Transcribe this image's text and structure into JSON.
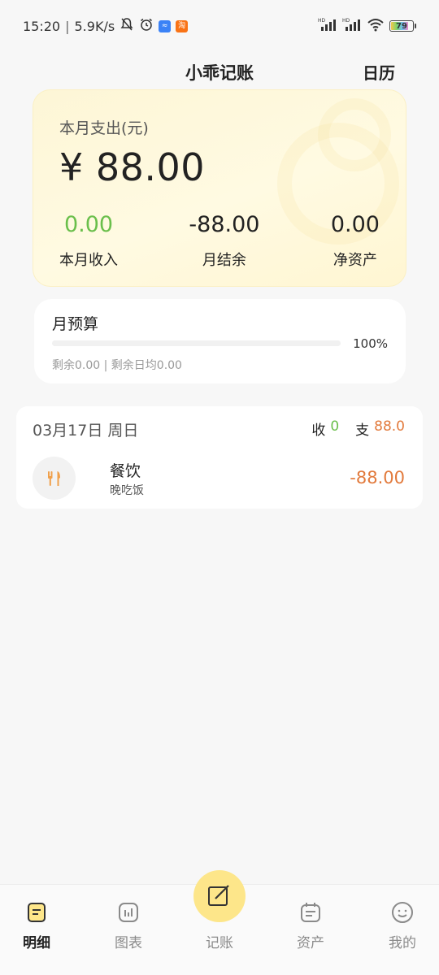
{
  "status_bar": {
    "time": "15:20",
    "net_speed": "5.9K/s",
    "battery": "79",
    "battery_level": 0.79,
    "taobao_badge": "淘"
  },
  "header": {
    "title": "小乖记账",
    "calendar": "日历"
  },
  "summary": {
    "label": "本月支出(元)",
    "amount": "¥ 88.00",
    "income_value": "0.00",
    "income_label": "本月收入",
    "balance_value": "-88.00",
    "balance_label": "月结余",
    "net_value": "0.00",
    "net_label": "净资产"
  },
  "budget": {
    "title": "月预算",
    "percent": "100%",
    "progress": 1.0,
    "sub": "剩余0.00 | 剩余日均0.00"
  },
  "day_group": {
    "date": "03月17日  周日",
    "income_label": "收",
    "income_value": "0",
    "expense_label": "支",
    "expense_value": "88.0",
    "records": [
      {
        "category": "餐饮",
        "note": "晚吃饭",
        "amount": "-88.00",
        "icon": "fork-knife-icon"
      }
    ]
  },
  "nav": {
    "items": [
      {
        "label": "明细",
        "icon": "list-icon",
        "active": true
      },
      {
        "label": "图表",
        "icon": "chart-icon",
        "active": false
      },
      {
        "label": "记账",
        "icon": "edit-icon",
        "active": false
      },
      {
        "label": "资产",
        "icon": "wallet-icon",
        "active": false
      },
      {
        "label": "我的",
        "icon": "smile-icon",
        "active": false
      }
    ]
  },
  "colors": {
    "income_green": "#6abf4b",
    "expense_orange": "#e27a3c",
    "accent_yellow": "#fde68a",
    "card_yellow": "#fffae2"
  }
}
